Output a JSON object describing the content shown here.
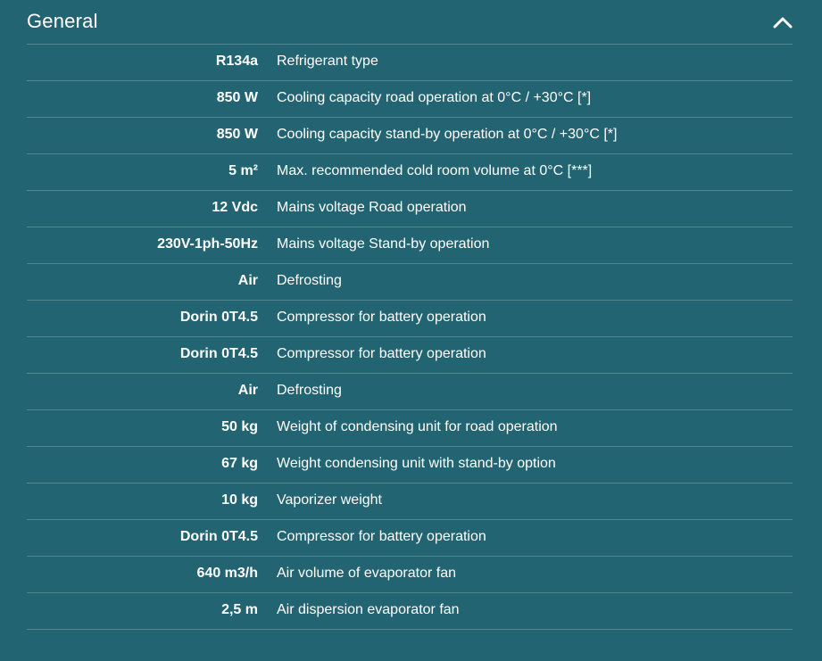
{
  "section": {
    "title": "General",
    "toggle_icon": "chevron-up-icon"
  },
  "specs": [
    {
      "value": "R134a",
      "label": "Refrigerant type"
    },
    {
      "value": "850 W",
      "label": "Cooling capacity road operation at 0°C / +30°C [*]"
    },
    {
      "value": "850 W",
      "label": "Cooling capacity stand-by operation at 0°C / +30°C [*]"
    },
    {
      "value": "5 m²",
      "label": "Max. recommended cold room volume at 0°C [***]"
    },
    {
      "value": "12 Vdc",
      "label": "Mains voltage Road operation"
    },
    {
      "value": "230V-1ph-50Hz",
      "label": "Mains voltage Stand-by operation"
    },
    {
      "value": "Air",
      "label": "Defrosting"
    },
    {
      "value": "Dorin 0T4.5",
      "label": "Compressor for battery operation"
    },
    {
      "value": "Dorin 0T4.5",
      "label": "Compressor for battery operation"
    },
    {
      "value": "Air",
      "label": "Defrosting"
    },
    {
      "value": "50 kg",
      "label": "Weight of condensing unit for road operation"
    },
    {
      "value": "67 kg",
      "label": "Weight condensing unit with stand-by option"
    },
    {
      "value": "10 kg",
      "label": "Vaporizer weight"
    },
    {
      "value": "Dorin 0T4.5",
      "label": "Compressor for battery operation"
    },
    {
      "value": "640 m3/h",
      "label": "Air volume of evaporator fan"
    },
    {
      "value": "2,5 m",
      "label": "Air dispersion evaporator fan"
    }
  ],
  "colors": {
    "background": "#236473",
    "text": "#ffffff",
    "divider": "rgba(255,255,255,0.22)"
  }
}
